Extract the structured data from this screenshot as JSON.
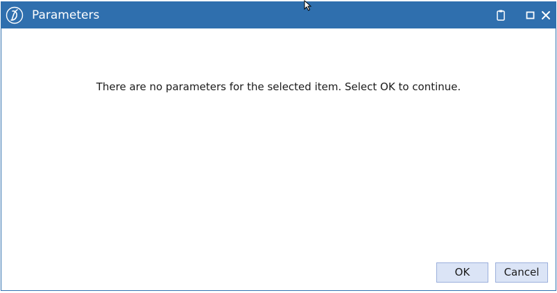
{
  "window": {
    "title": "Parameters",
    "titlebar_color": "#2f6fae",
    "icons": {
      "app_logo": "app-logo-icon",
      "clipboard": "clipboard-icon",
      "maximize": "maximize-icon",
      "close": "close-icon"
    }
  },
  "content": {
    "message": "There are no parameters for the selected item. Select OK to continue."
  },
  "buttons": {
    "ok_label": "OK",
    "cancel_label": "Cancel",
    "button_color": "#dbe4f6"
  }
}
